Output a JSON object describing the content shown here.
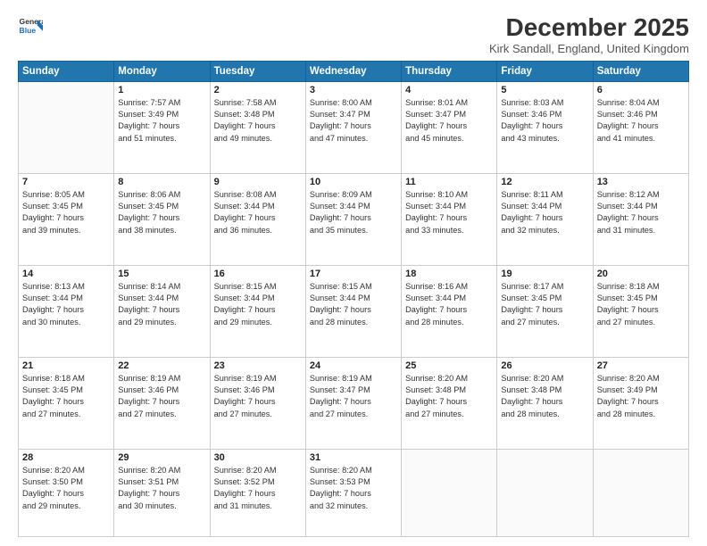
{
  "header": {
    "logo_line1": "General",
    "logo_line2": "Blue",
    "title": "December 2025",
    "subtitle": "Kirk Sandall, England, United Kingdom"
  },
  "days_of_week": [
    "Sunday",
    "Monday",
    "Tuesday",
    "Wednesday",
    "Thursday",
    "Friday",
    "Saturday"
  ],
  "weeks": [
    [
      {
        "day": "",
        "info": ""
      },
      {
        "day": "1",
        "info": "Sunrise: 7:57 AM\nSunset: 3:49 PM\nDaylight: 7 hours\nand 51 minutes."
      },
      {
        "day": "2",
        "info": "Sunrise: 7:58 AM\nSunset: 3:48 PM\nDaylight: 7 hours\nand 49 minutes."
      },
      {
        "day": "3",
        "info": "Sunrise: 8:00 AM\nSunset: 3:47 PM\nDaylight: 7 hours\nand 47 minutes."
      },
      {
        "day": "4",
        "info": "Sunrise: 8:01 AM\nSunset: 3:47 PM\nDaylight: 7 hours\nand 45 minutes."
      },
      {
        "day": "5",
        "info": "Sunrise: 8:03 AM\nSunset: 3:46 PM\nDaylight: 7 hours\nand 43 minutes."
      },
      {
        "day": "6",
        "info": "Sunrise: 8:04 AM\nSunset: 3:46 PM\nDaylight: 7 hours\nand 41 minutes."
      }
    ],
    [
      {
        "day": "7",
        "info": "Sunrise: 8:05 AM\nSunset: 3:45 PM\nDaylight: 7 hours\nand 39 minutes."
      },
      {
        "day": "8",
        "info": "Sunrise: 8:06 AM\nSunset: 3:45 PM\nDaylight: 7 hours\nand 38 minutes."
      },
      {
        "day": "9",
        "info": "Sunrise: 8:08 AM\nSunset: 3:44 PM\nDaylight: 7 hours\nand 36 minutes."
      },
      {
        "day": "10",
        "info": "Sunrise: 8:09 AM\nSunset: 3:44 PM\nDaylight: 7 hours\nand 35 minutes."
      },
      {
        "day": "11",
        "info": "Sunrise: 8:10 AM\nSunset: 3:44 PM\nDaylight: 7 hours\nand 33 minutes."
      },
      {
        "day": "12",
        "info": "Sunrise: 8:11 AM\nSunset: 3:44 PM\nDaylight: 7 hours\nand 32 minutes."
      },
      {
        "day": "13",
        "info": "Sunrise: 8:12 AM\nSunset: 3:44 PM\nDaylight: 7 hours\nand 31 minutes."
      }
    ],
    [
      {
        "day": "14",
        "info": "Sunrise: 8:13 AM\nSunset: 3:44 PM\nDaylight: 7 hours\nand 30 minutes."
      },
      {
        "day": "15",
        "info": "Sunrise: 8:14 AM\nSunset: 3:44 PM\nDaylight: 7 hours\nand 29 minutes."
      },
      {
        "day": "16",
        "info": "Sunrise: 8:15 AM\nSunset: 3:44 PM\nDaylight: 7 hours\nand 29 minutes."
      },
      {
        "day": "17",
        "info": "Sunrise: 8:15 AM\nSunset: 3:44 PM\nDaylight: 7 hours\nand 28 minutes."
      },
      {
        "day": "18",
        "info": "Sunrise: 8:16 AM\nSunset: 3:44 PM\nDaylight: 7 hours\nand 28 minutes."
      },
      {
        "day": "19",
        "info": "Sunrise: 8:17 AM\nSunset: 3:45 PM\nDaylight: 7 hours\nand 27 minutes."
      },
      {
        "day": "20",
        "info": "Sunrise: 8:18 AM\nSunset: 3:45 PM\nDaylight: 7 hours\nand 27 minutes."
      }
    ],
    [
      {
        "day": "21",
        "info": "Sunrise: 8:18 AM\nSunset: 3:45 PM\nDaylight: 7 hours\nand 27 minutes."
      },
      {
        "day": "22",
        "info": "Sunrise: 8:19 AM\nSunset: 3:46 PM\nDaylight: 7 hours\nand 27 minutes."
      },
      {
        "day": "23",
        "info": "Sunrise: 8:19 AM\nSunset: 3:46 PM\nDaylight: 7 hours\nand 27 minutes."
      },
      {
        "day": "24",
        "info": "Sunrise: 8:19 AM\nSunset: 3:47 PM\nDaylight: 7 hours\nand 27 minutes."
      },
      {
        "day": "25",
        "info": "Sunrise: 8:20 AM\nSunset: 3:48 PM\nDaylight: 7 hours\nand 27 minutes."
      },
      {
        "day": "26",
        "info": "Sunrise: 8:20 AM\nSunset: 3:48 PM\nDaylight: 7 hours\nand 28 minutes."
      },
      {
        "day": "27",
        "info": "Sunrise: 8:20 AM\nSunset: 3:49 PM\nDaylight: 7 hours\nand 28 minutes."
      }
    ],
    [
      {
        "day": "28",
        "info": "Sunrise: 8:20 AM\nSunset: 3:50 PM\nDaylight: 7 hours\nand 29 minutes."
      },
      {
        "day": "29",
        "info": "Sunrise: 8:20 AM\nSunset: 3:51 PM\nDaylight: 7 hours\nand 30 minutes."
      },
      {
        "day": "30",
        "info": "Sunrise: 8:20 AM\nSunset: 3:52 PM\nDaylight: 7 hours\nand 31 minutes."
      },
      {
        "day": "31",
        "info": "Sunrise: 8:20 AM\nSunset: 3:53 PM\nDaylight: 7 hours\nand 32 minutes."
      },
      {
        "day": "",
        "info": ""
      },
      {
        "day": "",
        "info": ""
      },
      {
        "day": "",
        "info": ""
      }
    ]
  ]
}
